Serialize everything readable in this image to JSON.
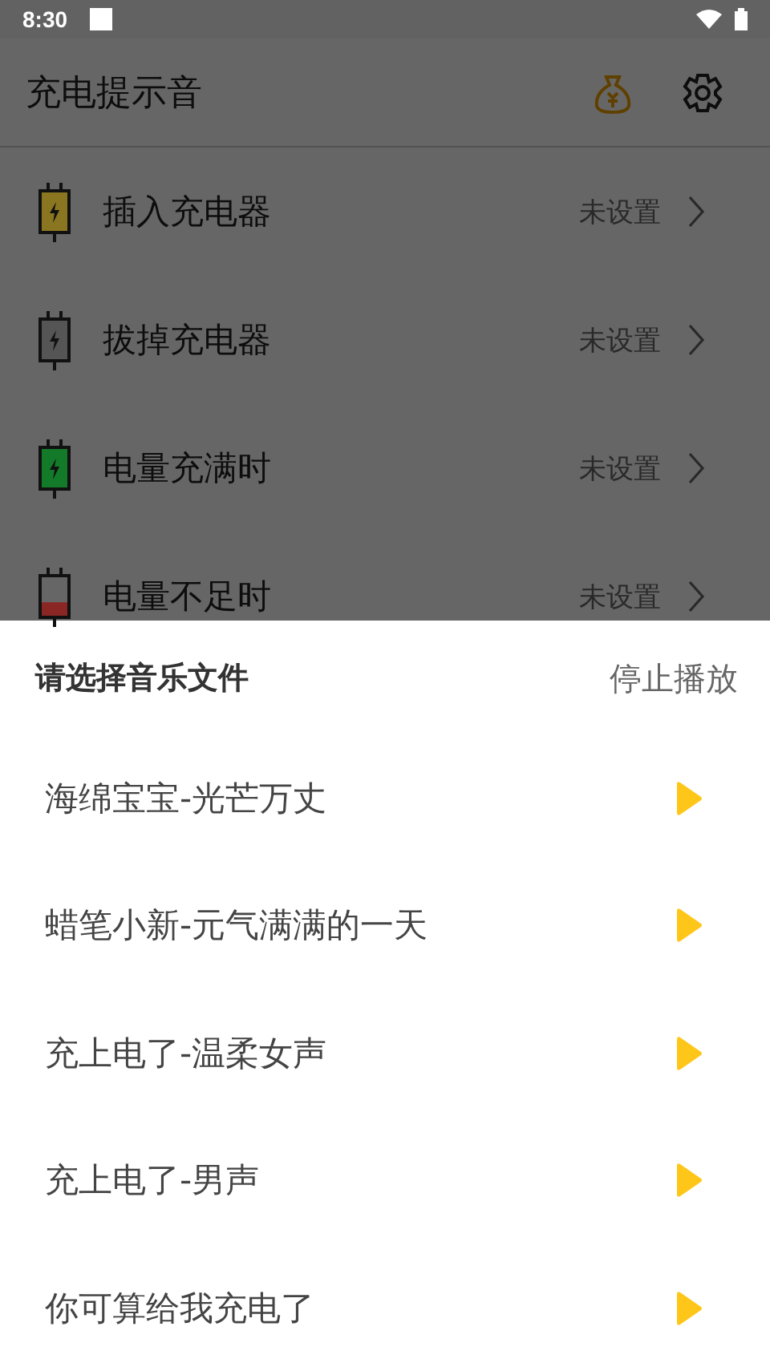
{
  "status_bar": {
    "time": "8:30"
  },
  "app_bar": {
    "title": "充电提示音"
  },
  "settings": [
    {
      "label": "插入充电器",
      "value": "未设置",
      "kind": "charging",
      "color": "#8a7620",
      "level": 1
    },
    {
      "label": "拔掉充电器",
      "value": "未设置",
      "kind": "charging",
      "color": "#555555",
      "level": 1
    },
    {
      "label": "电量充满时",
      "value": "未设置",
      "kind": "charging",
      "color": "#137a2a",
      "level": 1
    },
    {
      "label": "电量不足时",
      "value": "未设置",
      "kind": "low",
      "color": "#8a2624",
      "level": 0.35
    }
  ],
  "sheet": {
    "title": "请选择音乐文件",
    "stop_button": "停止播放",
    "tracks": [
      {
        "name": "海绵宝宝-光芒万丈"
      },
      {
        "name": "蜡笔小新-元气满满的一天"
      },
      {
        "name": "充上电了-温柔女声"
      },
      {
        "name": "充上电了-男声"
      },
      {
        "name": "你可算给我充电了"
      }
    ]
  }
}
